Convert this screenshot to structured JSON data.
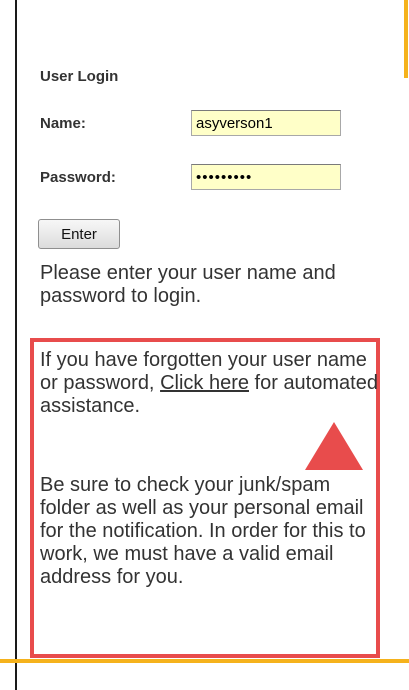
{
  "login": {
    "title": "User Login",
    "name_label": "Name:",
    "name_value": "asyverson1",
    "password_label": "Password:",
    "password_value": "password1",
    "enter_label": "Enter"
  },
  "instructions": "Please enter your user name and password to login.",
  "help": {
    "text_before_link": "If you have forgotten your user name or password, ",
    "link_text": "Click here",
    "text_after_link": " for automated assistance.",
    "note": "Be sure to check your junk/spam folder as well as your personal email for the notification. In order for this to work, we must have a valid email address for you."
  },
  "colors": {
    "highlight_border": "#e84c4c",
    "arrow": "#e84c4c",
    "input_background": "#ffffc8",
    "divider": "#f5b21c"
  },
  "icons": {
    "arrow": "up-triangle-arrow-icon"
  }
}
